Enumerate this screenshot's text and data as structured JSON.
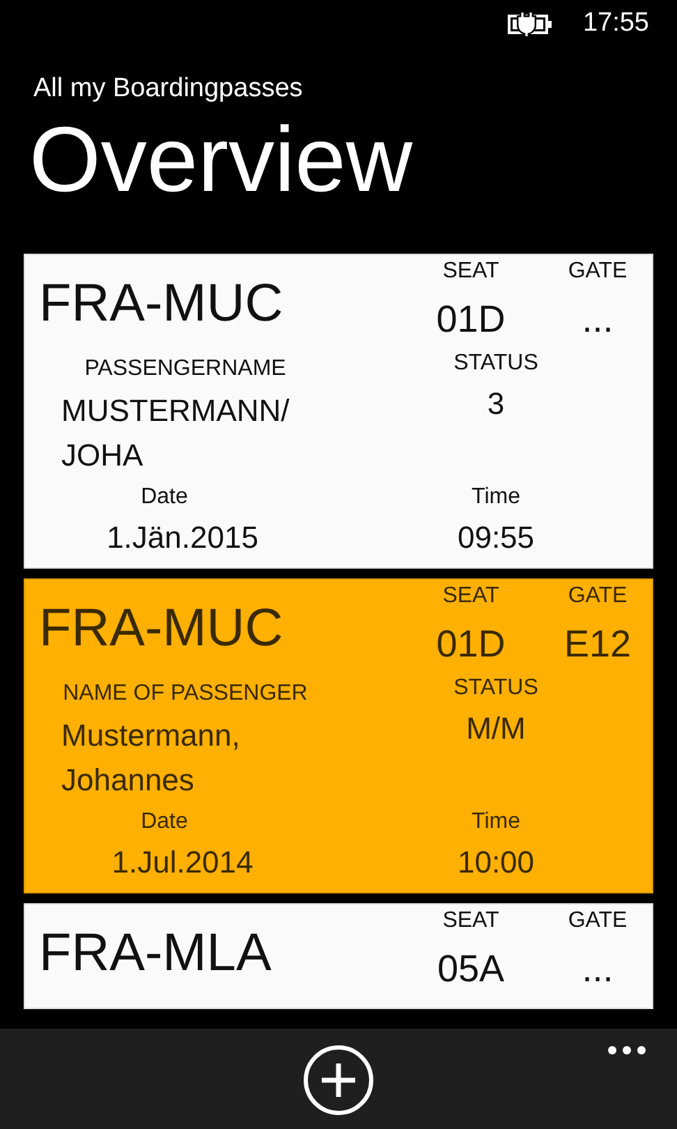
{
  "status_bar": {
    "time": "17:55"
  },
  "header": {
    "subtitle": "All my Boardingpasses",
    "title": "Overview"
  },
  "passes": [
    {
      "selected": false,
      "route": "FRA-MUC",
      "seat_label": "SEAT",
      "seat": "01D",
      "gate_label": "GATE",
      "gate": "...",
      "name_label": "PASSENGERNAME",
      "name_lines": [
        "MUSTERMANN/",
        "JOHA"
      ],
      "status_label": "STATUS",
      "status": "3",
      "date_label": "Date",
      "date": "1.Jän.2015",
      "time_label": "Time",
      "time": "09:55"
    },
    {
      "selected": true,
      "route": "FRA-MUC",
      "seat_label": "SEAT",
      "seat": "01D",
      "gate_label": "GATE",
      "gate": "E12",
      "name_label": "NAME OF PASSENGER",
      "name_lines": [
        "Mustermann,",
        "Johannes"
      ],
      "status_label": "STATUS",
      "status": "M/M",
      "date_label": "Date",
      "date": "1.Jul.2014",
      "time_label": "Time",
      "time": "10:00"
    },
    {
      "selected": false,
      "route": "FRA-MLA",
      "seat_label": "SEAT",
      "seat": "05A",
      "gate_label": "GATE",
      "gate": "..."
    }
  ]
}
